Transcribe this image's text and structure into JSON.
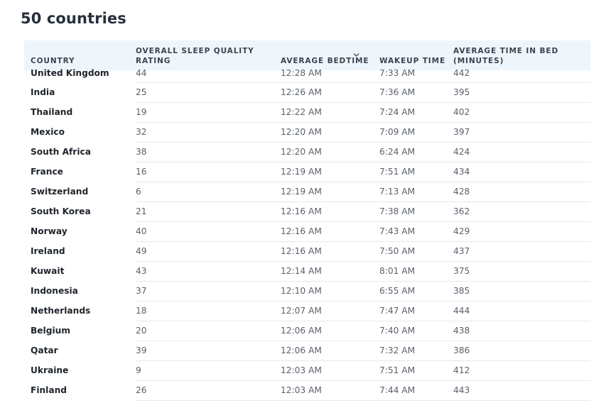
{
  "page": {
    "title": "50 countries"
  },
  "table": {
    "headers": {
      "country": "COUNTRY",
      "rating": "OVERALL SLEEP QUALITY RATING",
      "bedtime": "AVERAGE BEDTIME",
      "wakeup": "WAKEUP TIME",
      "time_in_bed": "AVERAGE TIME IN BED (MINUTES)"
    },
    "sort_icon": "chevron-down-icon",
    "rows": [
      {
        "country": "United Kingdom",
        "rating": "44",
        "bedtime": "12:28 AM",
        "wakeup": "7:33 AM",
        "time_in_bed": "442"
      },
      {
        "country": "India",
        "rating": "25",
        "bedtime": "12:26 AM",
        "wakeup": "7:36 AM",
        "time_in_bed": "395"
      },
      {
        "country": "Thailand",
        "rating": "19",
        "bedtime": "12:22 AM",
        "wakeup": "7:24 AM",
        "time_in_bed": "402"
      },
      {
        "country": "Mexico",
        "rating": "32",
        "bedtime": "12:20 AM",
        "wakeup": "7:09 AM",
        "time_in_bed": "397"
      },
      {
        "country": "South Africa",
        "rating": "38",
        "bedtime": "12:20 AM",
        "wakeup": "6:24 AM",
        "time_in_bed": "424"
      },
      {
        "country": "France",
        "rating": "16",
        "bedtime": "12:19 AM",
        "wakeup": "7:51 AM",
        "time_in_bed": "434"
      },
      {
        "country": "Switzerland",
        "rating": "6",
        "bedtime": "12:19 AM",
        "wakeup": "7:13 AM",
        "time_in_bed": "428"
      },
      {
        "country": "South Korea",
        "rating": "21",
        "bedtime": "12:16 AM",
        "wakeup": "7:38 AM",
        "time_in_bed": "362"
      },
      {
        "country": "Norway",
        "rating": "40",
        "bedtime": "12:16 AM",
        "wakeup": "7:43 AM",
        "time_in_bed": "429"
      },
      {
        "country": "Ireland",
        "rating": "49",
        "bedtime": "12:16 AM",
        "wakeup": "7:50 AM",
        "time_in_bed": "437"
      },
      {
        "country": "Kuwait",
        "rating": "43",
        "bedtime": "12:14 AM",
        "wakeup": "8:01 AM",
        "time_in_bed": "375"
      },
      {
        "country": "Indonesia",
        "rating": "37",
        "bedtime": "12:10 AM",
        "wakeup": "6:55 AM",
        "time_in_bed": "385"
      },
      {
        "country": "Netherlands",
        "rating": "18",
        "bedtime": "12:07 AM",
        "wakeup": "7:47 AM",
        "time_in_bed": "444"
      },
      {
        "country": "Belgium",
        "rating": "20",
        "bedtime": "12:06 AM",
        "wakeup": "7:40 AM",
        "time_in_bed": "438"
      },
      {
        "country": "Qatar",
        "rating": "39",
        "bedtime": "12:06 AM",
        "wakeup": "7:32 AM",
        "time_in_bed": "386"
      },
      {
        "country": "Ukraine",
        "rating": "9",
        "bedtime": "12:03 AM",
        "wakeup": "7:51 AM",
        "time_in_bed": "412"
      },
      {
        "country": "Finland",
        "rating": "26",
        "bedtime": "12:03 AM",
        "wakeup": "7:44 AM",
        "time_in_bed": "443"
      }
    ]
  }
}
